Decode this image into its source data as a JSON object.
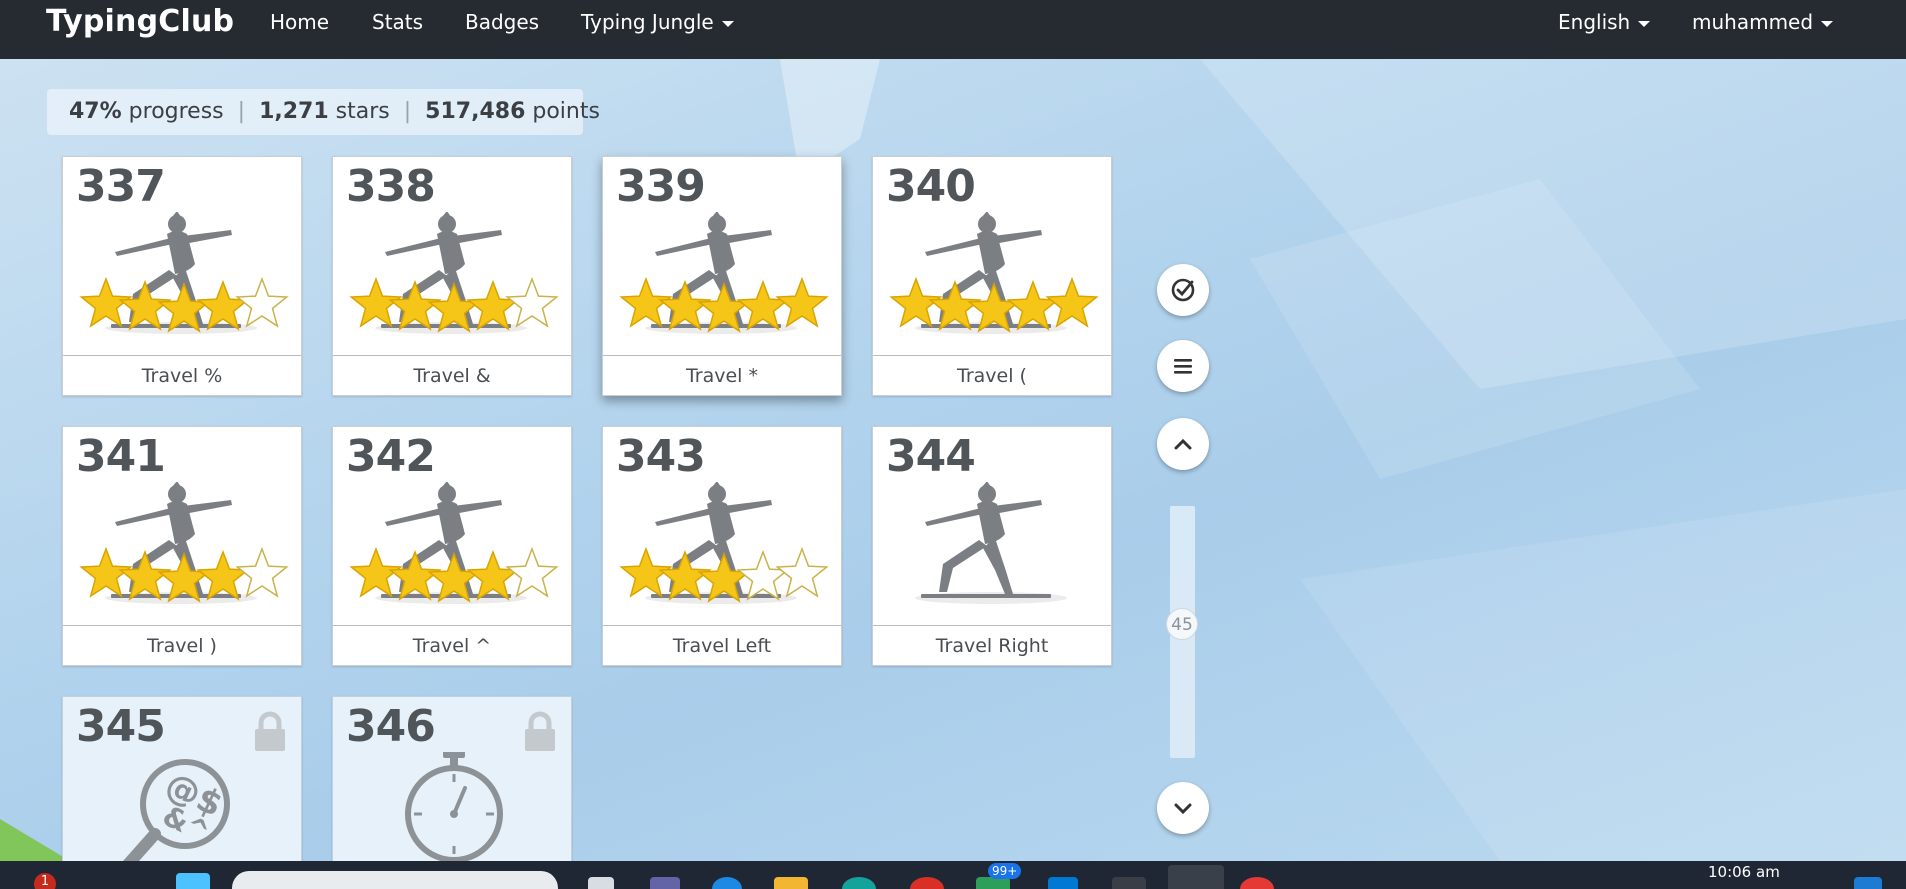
{
  "nav": {
    "brand": "TypingClub",
    "links": [
      "Home",
      "Stats",
      "Badges"
    ],
    "jungle_menu": "Typing Jungle",
    "language_menu": "English",
    "user_menu": "muhammed"
  },
  "stats": {
    "progress_value": "47%",
    "progress_label": "progress",
    "stars_value": "1,271",
    "stars_label": "stars",
    "points_value": "517,486",
    "points_label": "points",
    "separator": "|"
  },
  "lessons": [
    {
      "number": "337",
      "title": "Travel %",
      "stars": 4,
      "image": "yoga-pose",
      "locked": false
    },
    {
      "number": "338",
      "title": "Travel &",
      "stars": 4,
      "image": "yoga-pose",
      "locked": false
    },
    {
      "number": "339",
      "title": "Travel *",
      "stars": 5,
      "image": "yoga-pose",
      "locked": false
    },
    {
      "number": "340",
      "title": "Travel (",
      "stars": 5,
      "image": "yoga-pose",
      "locked": false
    },
    {
      "number": "341",
      "title": "Travel )",
      "stars": 4,
      "image": "yoga-pose",
      "locked": false
    },
    {
      "number": "342",
      "title": "Travel ^",
      "stars": 4,
      "image": "yoga-pose",
      "locked": false
    },
    {
      "number": "343",
      "title": "Travel Left",
      "stars": 3,
      "image": "yoga-pose",
      "locked": false
    },
    {
      "number": "344",
      "title": "Travel Right",
      "stars": 0,
      "image": "yoga-pose",
      "locked": false
    },
    {
      "number": "345",
      "title": "",
      "stars": 0,
      "image": "magnifier-symbols",
      "locked": true
    },
    {
      "number": "346",
      "title": "",
      "stars": 0,
      "image": "stopwatch",
      "locked": true
    }
  ],
  "side_controls": {
    "buttons": [
      "check-circle-icon",
      "menu-icon",
      "chevron-up-icon",
      "chevron-down-icon"
    ],
    "scroll_value": "45"
  },
  "taskbar": {
    "notification_count": "1",
    "badge_count": "99+",
    "clock_time": "10:06 am"
  },
  "colors": {
    "nav_bg": "#262b31",
    "star_gold": "#f5c518",
    "figure_gray": "#7b7f83"
  }
}
